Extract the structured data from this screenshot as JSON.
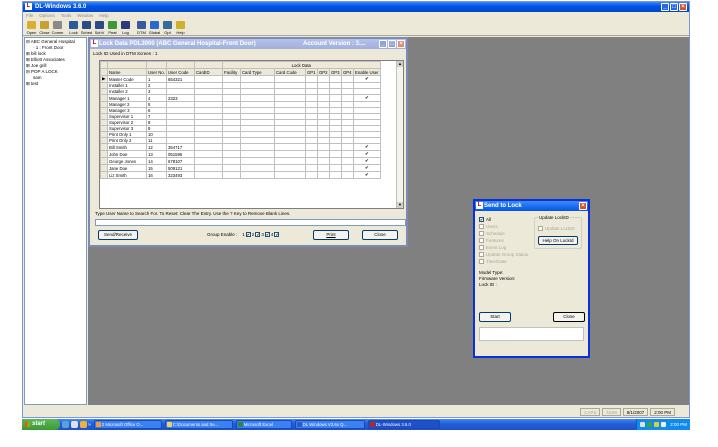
{
  "app": {
    "title": "DL-Windows 3.6.0",
    "icon_letter": "L"
  },
  "menu": [
    "File",
    "Options",
    "Tools",
    "Window",
    "Help"
  ],
  "toolbar": [
    {
      "label": "Open",
      "color": "#d8b030"
    },
    {
      "label": "Close",
      "color": "#c8a030"
    },
    {
      "label": "Comm",
      "color": "#8a8a8a"
    },
    {
      "label": "Lock",
      "color": "#2a5a9a"
    },
    {
      "label": "Sched",
      "color": "#2a4a8a"
    },
    {
      "label": "SchV",
      "color": "#2a4a8a"
    },
    {
      "label": "Peat",
      "color": "#3a9a3a"
    },
    {
      "label": "Log",
      "color": "#2a3a7a"
    },
    {
      "label": "DTM",
      "color": "#3a5aa0"
    },
    {
      "label": "Global",
      "color": "#2a6ad0"
    },
    {
      "label": "Opt",
      "color": "#3a6a9a"
    },
    {
      "label": "Help",
      "color": "#d0b030"
    }
  ],
  "tree": [
    "ABC General Hospital",
    "1 : Front Door",
    "bill lock",
    "Elliott Associates",
    "Joe grill",
    "POP A LOCK",
    "sam",
    "test"
  ],
  "lock_window": {
    "title": "Lock Data PDL3000 (ABC General Hospital-Front Door)",
    "account": "Account Version : 3....",
    "dtm_info": "Lock ID Used in DTM Screen : 1",
    "group_header": "Lock Data",
    "columns": [
      "Name",
      "User No.",
      "User Code",
      "CardID",
      "Facility",
      "Card Type",
      "Card Code",
      "GP1",
      "GP2",
      "GP3",
      "GP4",
      "Enable User"
    ],
    "rows": [
      [
        "Master Code",
        "1",
        "654321",
        "✔"
      ],
      [
        "Installer 1",
        "2",
        "",
        ""
      ],
      [
        "Installer 2",
        "3",
        "",
        ""
      ],
      [
        "Manager 1",
        "4",
        "2323",
        "✔"
      ],
      [
        "Manager 2",
        "5",
        "",
        ""
      ],
      [
        "Manager 3",
        "6",
        "",
        ""
      ],
      [
        "Supervisor 1",
        "7",
        "",
        ""
      ],
      [
        "Supervisor 2",
        "8",
        "",
        ""
      ],
      [
        "Supervisor 3",
        "9",
        "",
        ""
      ],
      [
        "Print Only 1",
        "10",
        "",
        ""
      ],
      [
        "Print Only 2",
        "11",
        "",
        ""
      ],
      [
        "Bill Smith",
        "12",
        "354717",
        "✔"
      ],
      [
        "John Doe",
        "13",
        "051595",
        "✔"
      ],
      [
        "George Jones",
        "14",
        "678107",
        "✔"
      ],
      [
        "Jane Doe",
        "15",
        "509121",
        "✔"
      ],
      [
        "Liz Smith",
        "16",
        "323493",
        "✔"
      ]
    ],
    "hint": "Type User Name to Search For. To Reset: Clear The Entry. Use the ? Key to Remove Blank Lines.",
    "send_receive": "Send/Receive",
    "group_enable_label": "Group Enable :",
    "groups": [
      "1",
      "2",
      "3",
      "4"
    ],
    "print": "Print",
    "close": "Close"
  },
  "send_window": {
    "title": "Send to Lock",
    "options": [
      {
        "label": "All",
        "checked": true,
        "enabled": true
      },
      {
        "label": "Users",
        "checked": false,
        "enabled": false
      },
      {
        "label": "Schedule",
        "checked": false,
        "enabled": false
      },
      {
        "label": "Features",
        "checked": false,
        "enabled": false
      },
      {
        "label": "Event Log",
        "checked": false,
        "enabled": false
      },
      {
        "label": "Update Group Status",
        "checked": false,
        "enabled": false
      },
      {
        "label": "Time/Date",
        "checked": false,
        "enabled": false
      }
    ],
    "group_title": "Update LockID",
    "update_lockid": "Update LockID",
    "help_lockid": "Help On LockId",
    "model_type": "Model Type:",
    "firmware": "Firmware Version:",
    "lock_id": "Lock ID :",
    "start": "Start",
    "close": "Close"
  },
  "status": {
    "caps": "CAPS",
    "num": "NUM",
    "date": "8/1/2007",
    "time": "2:00 PM"
  },
  "taskbar": {
    "start": "start",
    "quick_launch_more": "»",
    "tasks": [
      {
        "label": "2 Microsoft Office O...",
        "color": "#f0a030"
      },
      {
        "label": "C:\\Documents and Se...",
        "color": "#f0d070"
      },
      {
        "label": "Microsoft Excel",
        "color": "#2a8a3a"
      },
      {
        "label": "DL Windows V3.6x Q...",
        "color": "#2a5ad0"
      },
      {
        "label": "DL-Windows 3.6.0",
        "color": "#c02020"
      }
    ],
    "clock": "2:00 PM"
  }
}
